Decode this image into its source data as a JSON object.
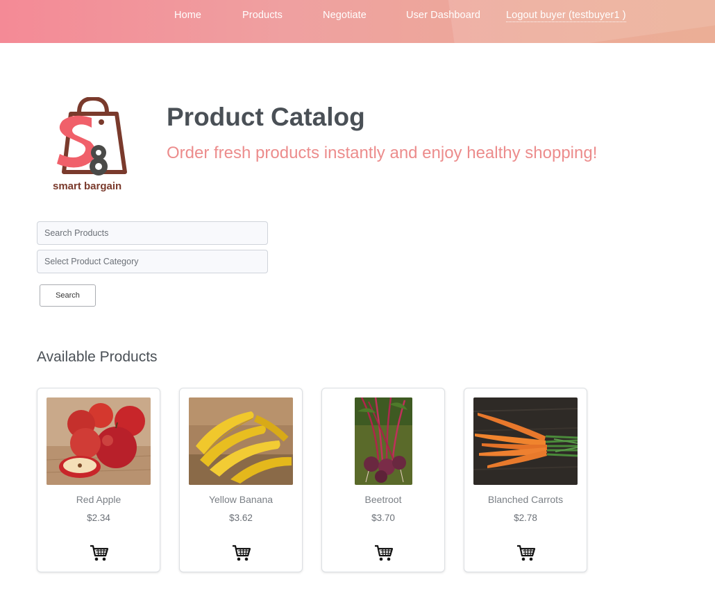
{
  "nav": {
    "home": "Home",
    "products": "Products",
    "negotiate": "Negotiate",
    "dashboard": "User Dashboard",
    "logout": "Logout buyer (testbuyer1 )"
  },
  "brand": {
    "logo_text": "smart bargain",
    "logo_letters": "S8",
    "colors": {
      "pink": "#f0606a",
      "brown": "#7a3a2c",
      "gray": "#4a4a48"
    }
  },
  "hero": {
    "title": "Product Catalog",
    "subtitle": "Order fresh products instantly and enjoy healthy shopping!"
  },
  "search": {
    "search_placeholder": "Search Products",
    "category_placeholder": "Select Product Category",
    "button_label": "Search"
  },
  "section_title": "Available Products",
  "products": [
    {
      "name": "Red Apple",
      "price": "$2.34",
      "image": "red-apples-photo",
      "cart_icon": "shopping-cart-icon"
    },
    {
      "name": "Yellow Banana",
      "price": "$3.62",
      "image": "bananas-photo",
      "cart_icon": "shopping-cart-icon"
    },
    {
      "name": "Beetroot",
      "price": "$3.70",
      "image": "beetroot-photo",
      "cart_icon": "shopping-cart-icon"
    },
    {
      "name": "Blanched Carrots",
      "price": "$2.78",
      "image": "carrots-photo",
      "cart_icon": "shopping-cart-icon"
    }
  ],
  "colors": {
    "nav_gradient_start": "#f48a96",
    "nav_gradient_end": "#ebae96",
    "title": "#4a5056",
    "subtitle": "#ec8c8c"
  }
}
